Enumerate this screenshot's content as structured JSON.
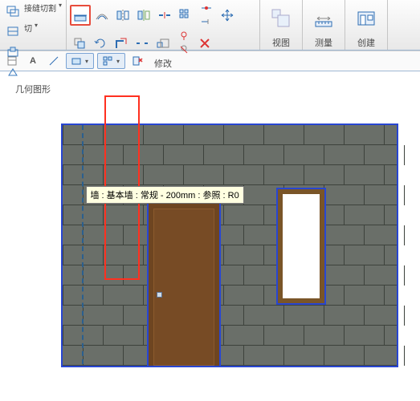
{
  "ribbon": {
    "cut_label": "接缝切割",
    "cut_drop": "切",
    "panels": {
      "geometry": "几何图形",
      "modify": "修改",
      "view": "视图",
      "measure": "测量",
      "create": "创建"
    }
  },
  "tooltip": "墙 : 基本墙 : 常规 - 200mm : 参照 : R0",
  "icons": {
    "cut1": "接缝切割",
    "cut2": "切",
    "align": "对齐",
    "offset": "偏移",
    "mirror_axis": "镜像-轴",
    "mirror_draw": "镜像-绘制",
    "move": "移动",
    "copy": "复制",
    "rotate": "旋转",
    "trim": "修剪",
    "split": "拆分",
    "array": "阵列",
    "scale": "缩放",
    "pin": "锁定",
    "delete": "删除",
    "extend": "延伸",
    "corner": "角部",
    "gap": "间隙",
    "view": "视图",
    "measure": "测量",
    "create": "创建",
    "prop": "属性",
    "text": "文字",
    "dim": "尺寸",
    "filter": "过滤器",
    "select": "选择",
    "close": "关闭"
  }
}
